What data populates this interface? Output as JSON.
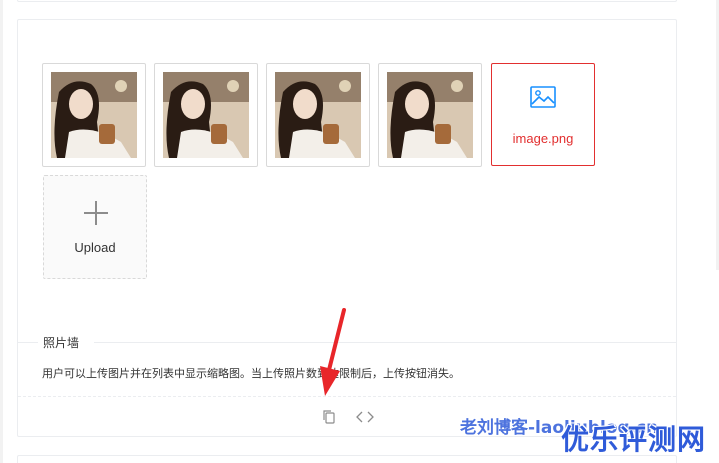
{
  "upload_list": {
    "images": [
      {
        "alt": "photo-1"
      },
      {
        "alt": "photo-2"
      },
      {
        "alt": "photo-3"
      },
      {
        "alt": "photo-4"
      }
    ],
    "error_file": {
      "name": "image.png",
      "color": "#e22f2f",
      "icon": "image-icon"
    },
    "upload_button": {
      "label": "Upload",
      "icon": "plus-icon"
    }
  },
  "section": {
    "title": "照片墙",
    "description": "用户可以上传图片并在列表中显示缩略图。当上传照片数到达限制后，上传按钮消失。"
  },
  "actions": {
    "copy_icon": "copy-icon",
    "code_icon": "code-icon"
  },
  "watermarks": {
    "blog": "老刘博客-laoliublog.cn",
    "site": "优乐评测网",
    "color": "#2f5bd9"
  },
  "annotation": {
    "arrow_color": "#e8262a"
  }
}
